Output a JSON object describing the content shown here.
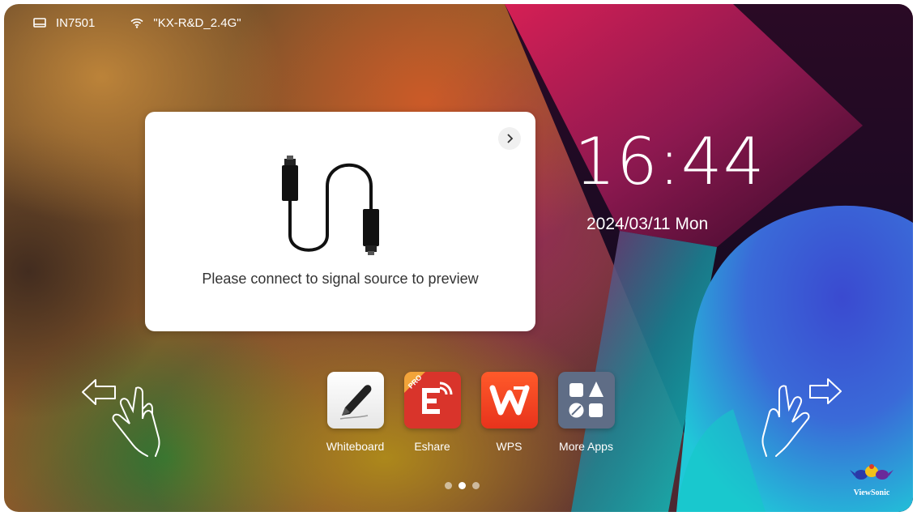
{
  "status": {
    "device_name": "IN7501",
    "wifi_name": "\"KX-R&D_2.4G\""
  },
  "preview": {
    "message": "Please connect to signal source to preview"
  },
  "clock": {
    "time": "16:44",
    "date": "2024/03/11 Mon"
  },
  "apps": [
    {
      "label": "Whiteboard",
      "icon": "pen-icon"
    },
    {
      "label": "Eshare",
      "icon": "eshare-icon",
      "badge": "PRO"
    },
    {
      "label": "WPS",
      "icon": "wps-icon"
    },
    {
      "label": "More Apps",
      "icon": "apps-grid-icon"
    }
  ],
  "pagination": {
    "pages": 3,
    "active": 2
  },
  "brand": {
    "name": "ViewSonic"
  },
  "colors": {
    "eshare_red": "#d9342b",
    "wps_orange": "#f4471f",
    "more_apps_gray": "#5f6d86"
  }
}
